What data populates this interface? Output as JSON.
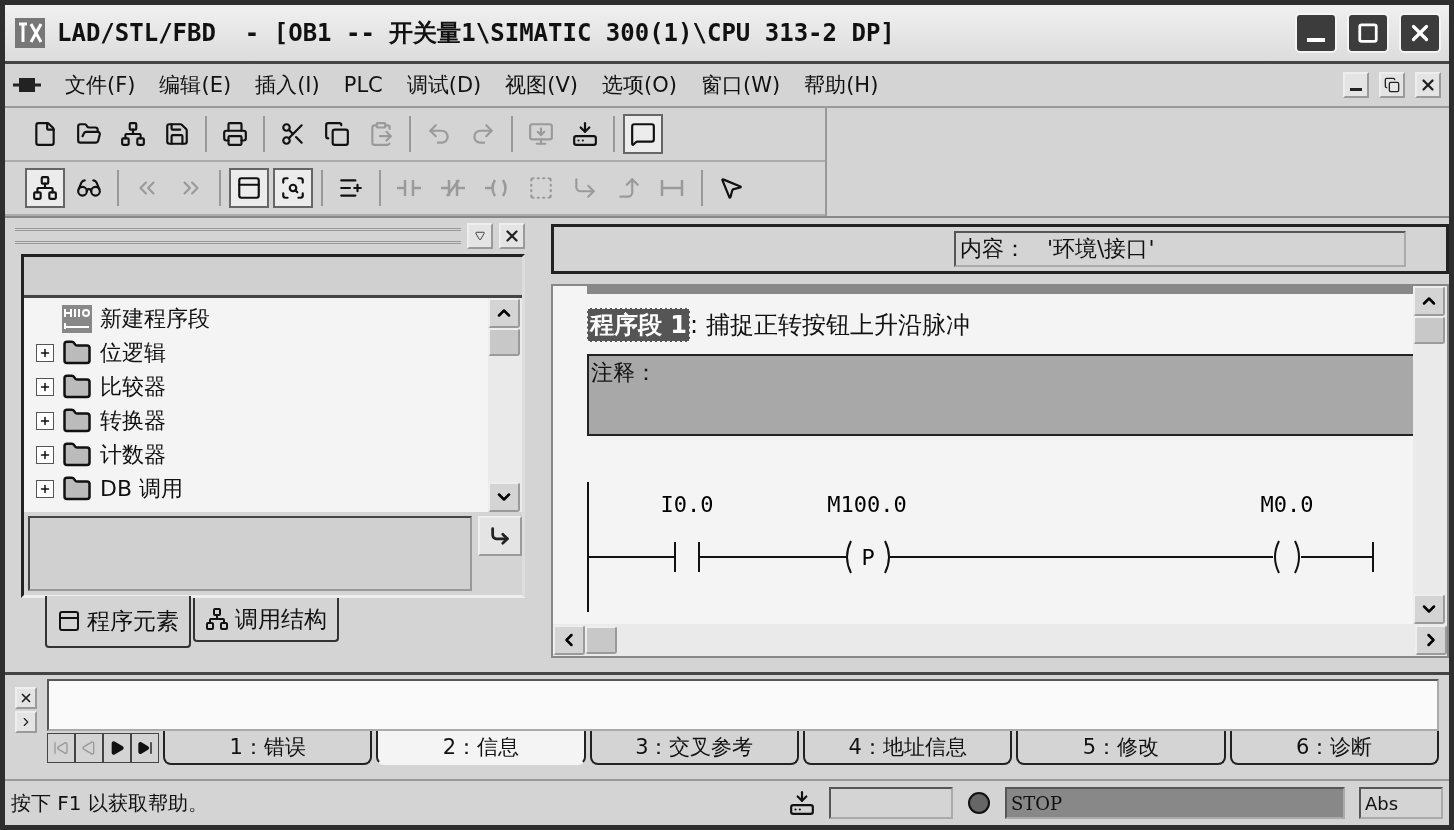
{
  "window": {
    "title": "LAD/STL/FBD  - [OB1 -- 开关量1\\SIMATIC 300(1)\\CPU 313-2 DP]"
  },
  "menu": {
    "items": [
      {
        "label": "文件(F)"
      },
      {
        "label": "编辑(E)"
      },
      {
        "label": "插入(I)"
      },
      {
        "label": "PLC"
      },
      {
        "label": "调试(D)"
      },
      {
        "label": "视图(V)"
      },
      {
        "label": "选项(O)"
      },
      {
        "label": "窗口(W)"
      },
      {
        "label": "帮助(H)"
      }
    ]
  },
  "toolbars": [
    [
      {
        "kind": "new",
        "disabled": false,
        "pressed": false
      },
      {
        "kind": "open",
        "disabled": false,
        "pressed": false
      },
      {
        "kind": "nodes",
        "disabled": false,
        "pressed": false
      },
      {
        "kind": "save",
        "disabled": false,
        "pressed": false
      },
      {
        "kind": "sep"
      },
      {
        "kind": "print",
        "disabled": false,
        "pressed": false
      },
      {
        "kind": "sep"
      },
      {
        "kind": "cut",
        "disabled": false,
        "pressed": false
      },
      {
        "kind": "copy",
        "disabled": false,
        "pressed": false
      },
      {
        "kind": "paste",
        "disabled": true,
        "pressed": false
      },
      {
        "kind": "sep"
      },
      {
        "kind": "undo",
        "disabled": true,
        "pressed": false
      },
      {
        "kind": "redo",
        "disabled": true,
        "pressed": false
      },
      {
        "kind": "sep"
      },
      {
        "kind": "monitor",
        "disabled": true,
        "pressed": false
      },
      {
        "kind": "download",
        "disabled": false,
        "pressed": false
      },
      {
        "kind": "sep"
      },
      {
        "kind": "comment",
        "disabled": false,
        "pressed": true
      }
    ],
    [
      {
        "kind": "nodes",
        "disabled": false,
        "pressed": true
      },
      {
        "kind": "glasses",
        "disabled": false,
        "pressed": false
      },
      {
        "kind": "sep"
      },
      {
        "kind": "prev",
        "disabled": true,
        "pressed": false
      },
      {
        "kind": "next",
        "disabled": true,
        "pressed": false
      },
      {
        "kind": "sep"
      },
      {
        "kind": "window",
        "disabled": false,
        "pressed": true
      },
      {
        "kind": "overview",
        "disabled": false,
        "pressed": true
      },
      {
        "kind": "sep"
      },
      {
        "kind": "network",
        "disabled": false,
        "pressed": false
      },
      {
        "kind": "sep"
      },
      {
        "kind": "contact",
        "disabled": true,
        "pressed": false
      },
      {
        "kind": "ncontact",
        "disabled": true,
        "pressed": false
      },
      {
        "kind": "coil",
        "disabled": true,
        "pressed": false
      },
      {
        "kind": "box",
        "disabled": true,
        "pressed": false
      },
      {
        "kind": "branch",
        "disabled": true,
        "pressed": false
      },
      {
        "kind": "close",
        "disabled": true,
        "pressed": false
      },
      {
        "kind": "jump",
        "disabled": true,
        "pressed": false
      },
      {
        "kind": "sep"
      },
      {
        "kind": "help",
        "disabled": false,
        "pressed": false
      }
    ]
  ],
  "left_panel": {
    "tree": [
      {
        "label": "新建程序段",
        "kind": "network"
      },
      {
        "label": "位逻辑",
        "kind": "folder",
        "expanded": false
      },
      {
        "label": "比较器",
        "kind": "folder",
        "expanded": false
      },
      {
        "label": "转换器",
        "kind": "folder",
        "expanded": false
      },
      {
        "label": "计数器",
        "kind": "folder",
        "expanded": false
      },
      {
        "label": "DB 调用",
        "kind": "folder",
        "expanded": false
      }
    ],
    "tabs": [
      {
        "label": "程序元素",
        "selected": true
      },
      {
        "label": "调用结构",
        "selected": false
      }
    ]
  },
  "editor": {
    "info_field": "内容：   '环境\\接口'",
    "network_title": "程序段 1",
    "network_comment": ": 捕捉正转按钮上升沿脉冲",
    "comment_label": "注释：",
    "rung": [
      {
        "kind": "contact",
        "address": "I0.0"
      },
      {
        "kind": "edge_coil",
        "address": "M100.0",
        "symbol": "P"
      },
      {
        "kind": "coil",
        "address": "M0.0"
      }
    ]
  },
  "output": {
    "tabs": [
      {
        "label": "1：错误",
        "selected": false
      },
      {
        "label": "2：信息",
        "selected": true
      },
      {
        "label": "3：交叉参考",
        "selected": false
      },
      {
        "label": "4：地址信息",
        "selected": false
      },
      {
        "label": "5：修改",
        "selected": false
      },
      {
        "label": "6：诊断",
        "selected": false
      }
    ]
  },
  "status_bar": {
    "help": "按下 F1 以获取帮助。",
    "mode": "STOP",
    "addressing": "Abs"
  }
}
